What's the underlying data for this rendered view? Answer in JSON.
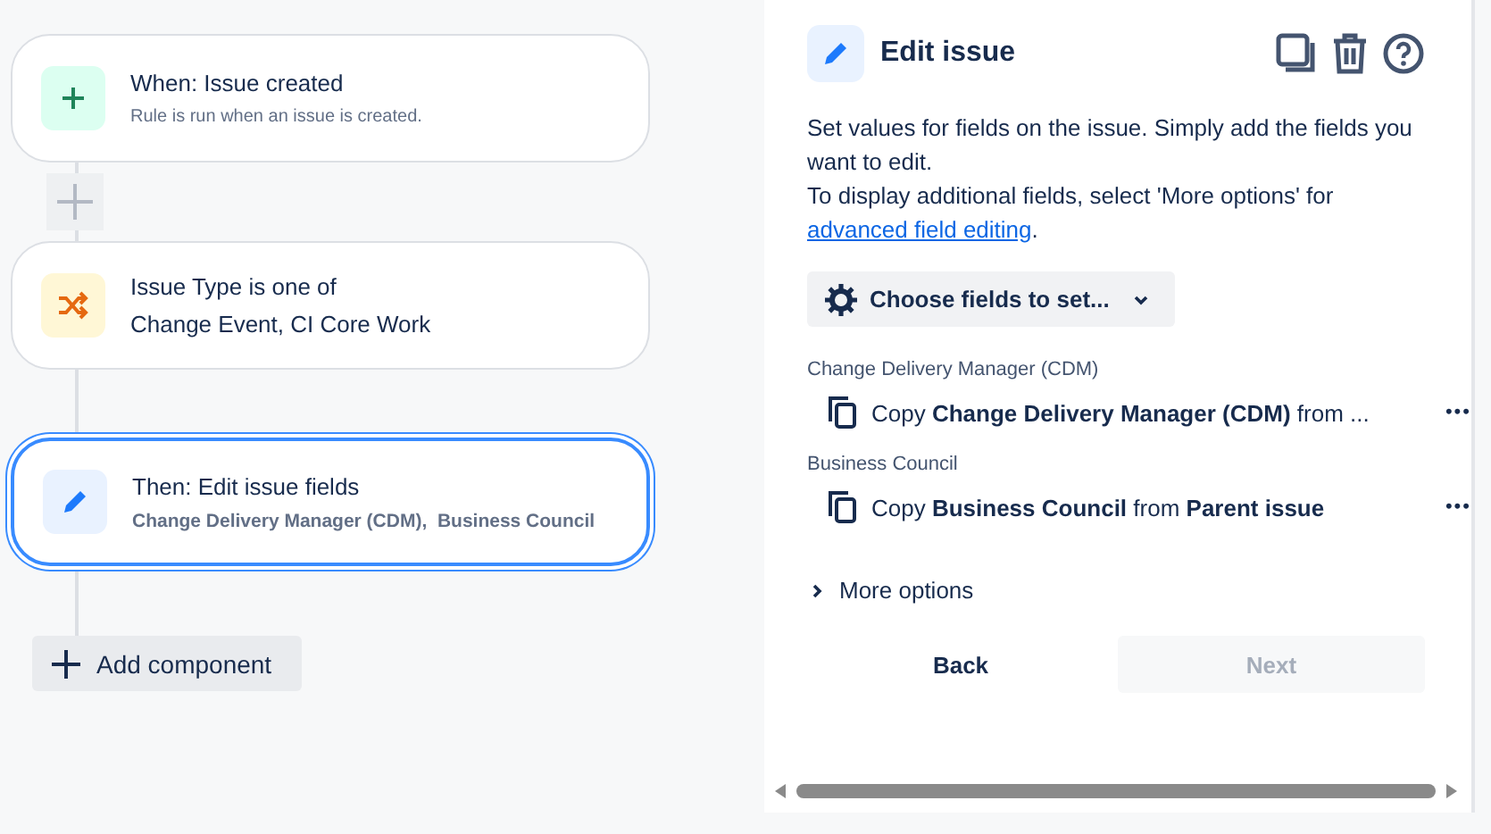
{
  "flow": {
    "nodes": [
      {
        "kind": "trigger",
        "title": "When: Issue created",
        "subtitle": "Rule is run when an issue is created.",
        "selected": false
      },
      {
        "kind": "condition",
        "title": "Issue Type is one of",
        "subtitle": "Change Event, CI Core Work",
        "selected": false
      },
      {
        "kind": "action",
        "title": "Then: Edit issue fields",
        "subtitle": "Change Delivery Manager (CDM),  Business Council",
        "selected": true
      }
    ],
    "add_button": "Add component"
  },
  "panel": {
    "title": "Edit issue",
    "description": "Set values for fields on the issue. Simply add the fields you want to edit.",
    "hint": "To display additional fields, select 'More options' for",
    "link": "advanced field editing",
    "hint_end": ".",
    "choose_button": "Choose fields to set...",
    "fields": [
      {
        "label": "Change Delivery Manager (CDM)",
        "value": "Copy **Change Delivery Manager (CDM)** from ...",
        "more": "•••"
      },
      {
        "label": "Business Council",
        "value": "Copy **Business Council** from **Parent issue**",
        "more": "•••"
      }
    ],
    "more_options": "More options",
    "expanded": false,
    "buttons": [
      {
        "label": "Back",
        "disabled": false
      },
      {
        "label": "Next",
        "disabled": true
      }
    ]
  }
}
